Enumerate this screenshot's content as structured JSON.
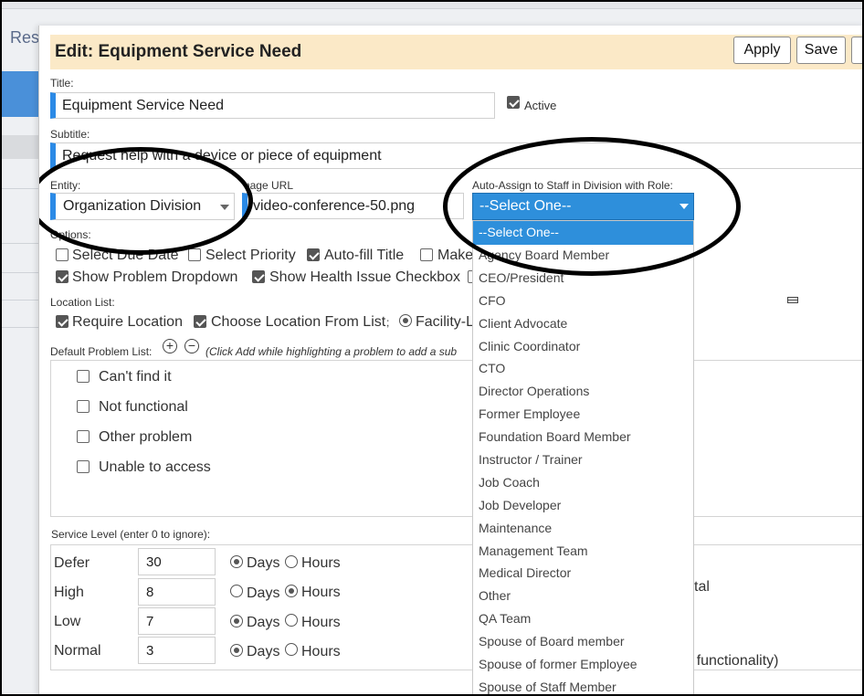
{
  "background": {
    "title_fragment": "Res"
  },
  "dialog": {
    "title": "Edit: Equipment Service Need",
    "buttons": {
      "apply": "Apply",
      "save": "Save"
    }
  },
  "form": {
    "title_label": "Title:",
    "title_value": "Equipment Service Need",
    "active_label": "Active",
    "subtitle_label": "Subtitle:",
    "subtitle_value": "Request help with a device or piece of equipment",
    "entity_label": "Entity:",
    "entity_value": "Organization Division",
    "image_url_label": "Image URL:",
    "image_url_value": "video-conference-50.png",
    "auto_assign_label": "Auto-Assign to Staff in Division with Role:",
    "auto_assign_value": "--Select One--",
    "options_label": "Options:",
    "options": {
      "select_due_date": "Select Due Date",
      "select_priority": "Select Priority",
      "auto_fill_title": "Auto-fill Title",
      "make": "Make",
      "show_problem_dropdown": "Show Problem Dropdown",
      "show_health_issue": "Show Health Issue Checkbox"
    },
    "location_list_label": "Location List:",
    "require_location": "Require Location",
    "choose_location": "Choose Location From List",
    "choose_location_suffix": ";",
    "facility_label": "Facility-L",
    "default_problem_label": "Default Problem List:",
    "default_problem_hint": "(Click Add while highlighting a problem to add a sub",
    "problems": [
      "Can't find it",
      "Not functional",
      "Other problem",
      "Unable to access"
    ],
    "service_level_label": "Service Level (enter 0 to ignore):",
    "service_levels": [
      {
        "name": "Defer",
        "value": "30",
        "unit": "Days"
      },
      {
        "name": "High",
        "value": "8",
        "unit": "Hours"
      },
      {
        "name": "Low",
        "value": "7",
        "unit": "Days"
      },
      {
        "name": "Normal",
        "value": "3",
        "unit": "Days"
      }
    ],
    "days_label": "Days",
    "hours_label": "Hours",
    "right_fragment_1": "tal",
    "right_fragment_2": "ete functionality)"
  },
  "role_dropdown": {
    "items": [
      "--Select One--",
      "Agency Board Member",
      "CEO/President",
      "CFO",
      "Client Advocate",
      "Clinic Coordinator",
      "CTO",
      "Director Operations",
      "Former Employee",
      "Foundation Board Member",
      "Instructor / Trainer",
      "Job Coach",
      "Job Developer",
      "Maintenance",
      "Management Team",
      "Medical Director",
      "Other",
      "QA Team",
      "Spouse of Board member",
      "Spouse of former Employee",
      "Spouse of Staff Member"
    ],
    "selected_index": 0
  },
  "colors": {
    "accent": "#2e8fdb",
    "header_bg": "#fbe9c7",
    "field_bar": "#2b8ae6"
  }
}
